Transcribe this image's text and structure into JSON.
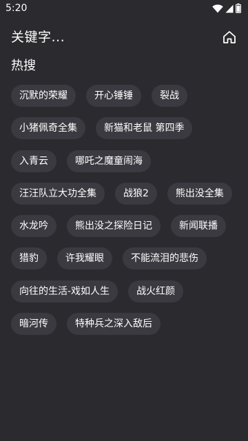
{
  "status_bar": {
    "time": "5:20",
    "icons": [
      "wifi-icon",
      "cellular-signal-icon",
      "battery-icon"
    ]
  },
  "header": {
    "search_text": "关键字...",
    "home_icon": "home-icon"
  },
  "hot_search": {
    "title": "热搜",
    "rows": [
      [
        "沉默的荣耀",
        "开心锤锤",
        "裂战"
      ],
      [
        "小猪佩奇全集",
        "新猫和老鼠 第四季"
      ],
      [
        "入青云",
        "哪吒之魔童闹海"
      ],
      [
        "汪汪队立大功全集",
        "战狼2",
        "熊出没全集"
      ],
      [
        "水龙吟",
        "熊出没之探险日记",
        "新闻联播"
      ],
      [
        "猎豹",
        "许我耀眼",
        "不能流泪的悲伤"
      ],
      [
        "向往的生活-戏如人生",
        "战火红颜"
      ],
      [
        "暗河传",
        "特种兵之深入敌后"
      ]
    ]
  },
  "colors": {
    "background": "#2b2a2f",
    "tag_background": "#3b3a40",
    "text": "#ffffff"
  }
}
